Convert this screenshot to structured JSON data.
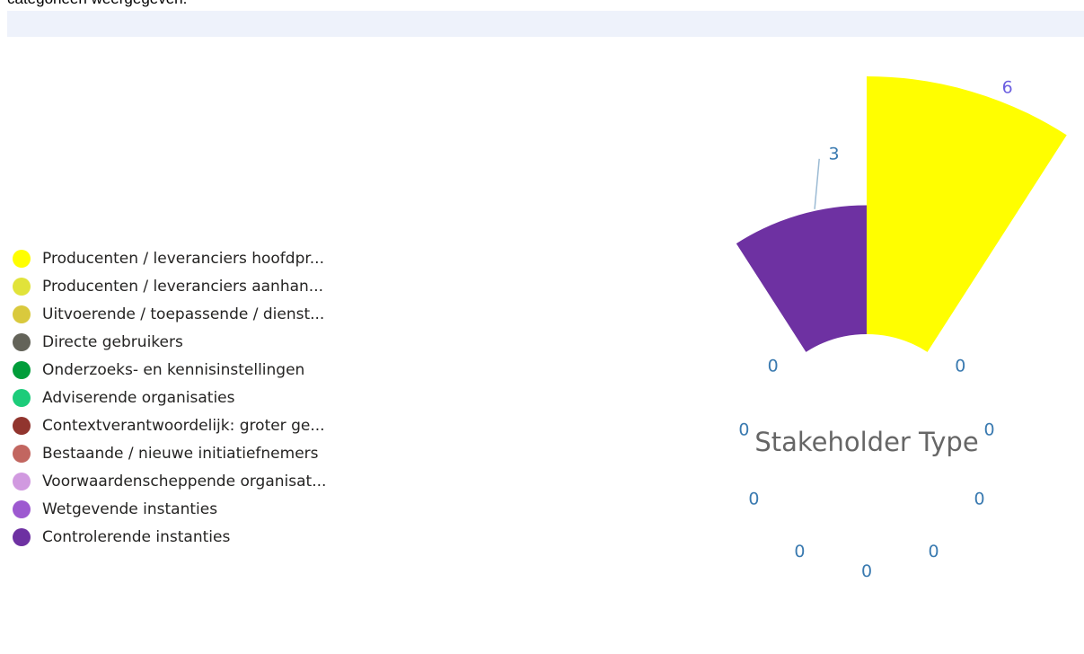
{
  "page": {
    "top_text": "categorieën weergegeven.",
    "top_bar_color": "#eef2fb"
  },
  "chart_data": {
    "type": "pie",
    "variant": "rose",
    "title": "Stakeholder Type",
    "legend_placement": "left",
    "categories": [
      "Producenten / leveranciers hoofdpr...",
      "Producenten / leveranciers aanhan...",
      "Uitvoerende / toepassende / dienst...",
      "Directe gebruikers",
      "Onderzoeks- en kennisinstellingen",
      "Adviserende organisaties",
      "Contextverantwoordelijk: groter ge...",
      "Bestaande / nieuwe initiatiefnemers",
      "Voorwaardenscheppende organisat...",
      "Wetgevende instanties",
      "Controlerende instanties"
    ],
    "colors": [
      "#fffe00",
      "#e1e33a",
      "#d9c93d",
      "#636359",
      "#019d3a",
      "#1ccc7a",
      "#91352e",
      "#c26660",
      "#d19ae0",
      "#9d59d0",
      "#6e31a2"
    ],
    "values": [
      6,
      0,
      0,
      0,
      0,
      0,
      0,
      0,
      0,
      0,
      3
    ],
    "data_labels": [
      "6",
      "0",
      "0",
      "0",
      "0",
      "0",
      "0",
      "0",
      "0",
      "0",
      "3"
    ],
    "label_color": "#3a7ab0",
    "max_label_color": "#6b5ee0"
  }
}
